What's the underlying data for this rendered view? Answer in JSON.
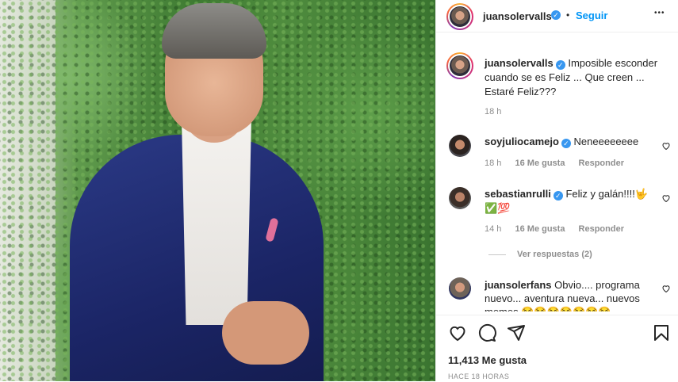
{
  "post": {
    "author": "juansolervalls",
    "follow_label": "Seguir",
    "dot": "•",
    "more_label": "•••",
    "caption": "Imposible esconder cuando se es Feliz ... Que creen ... Estaré Feliz???",
    "caption_time": "18 h"
  },
  "comments": [
    {
      "user": "soyjuliocamejo",
      "text": "Neneeeeeeee",
      "time": "18 h",
      "likes": "16 Me gusta",
      "reply": "Responder"
    },
    {
      "user": "sebastianrulli",
      "text": "Feliz y galán!!!!🤟",
      "text2": "✅💯",
      "time": "14 h",
      "likes": "16 Me gusta",
      "reply": "Responder"
    },
    {
      "user": "juansolerfans",
      "text": "Obvio.... programa nuevo... aventura nueva... nuevos memes 😂😂😂😂😂😂😂"
    }
  ],
  "view_replies": "Ver respuestas (2)",
  "likes_total": "11,413 Me gusta",
  "posted_ago": "HACE 18 HORAS",
  "colors": {
    "accent": "#0095f6",
    "verified": "#3897f0",
    "text": "#262626",
    "muted": "#8e8e8e"
  },
  "icons": [
    "heart-icon",
    "comment-icon",
    "share-icon",
    "bookmark-icon",
    "more-icon",
    "verified-icon"
  ]
}
